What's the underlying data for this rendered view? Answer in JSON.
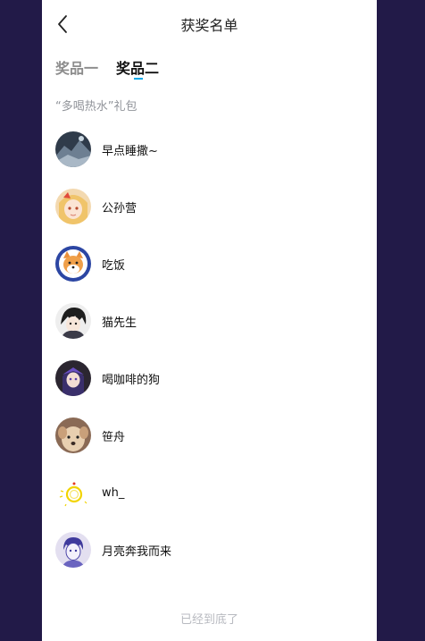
{
  "header": {
    "title": "获奖名单",
    "back_icon": "chevron-left-icon"
  },
  "tabs": [
    {
      "label": "奖品一"
    },
    {
      "label": "奖品二"
    }
  ],
  "section": {
    "title": "“多喝热水”礼包"
  },
  "winners": [
    {
      "name": "早点睡撒~",
      "avatar": "avatar-dark-mountain"
    },
    {
      "name": "公孙营",
      "avatar": "avatar-anime-girl-blonde"
    },
    {
      "name": "吃饭",
      "avatar": "avatar-shiba-dog"
    },
    {
      "name": "猫先生",
      "avatar": "avatar-anime-boy-dark-hair"
    },
    {
      "name": "喝咖啡的狗",
      "avatar": "avatar-anime-purple-hair"
    },
    {
      "name": "笹舟",
      "avatar": "avatar-small-dog-photo"
    },
    {
      "name": "wh_",
      "avatar": "avatar-yellow-ring"
    },
    {
      "name": "月亮奔我而来",
      "avatar": "avatar-sketch-portrait"
    }
  ],
  "footer": {
    "text": "已经到底了"
  },
  "colors": {
    "background": "#221a48",
    "panel": "#ffffff",
    "accent": "#00a9e8",
    "muted_text": "#909399"
  }
}
